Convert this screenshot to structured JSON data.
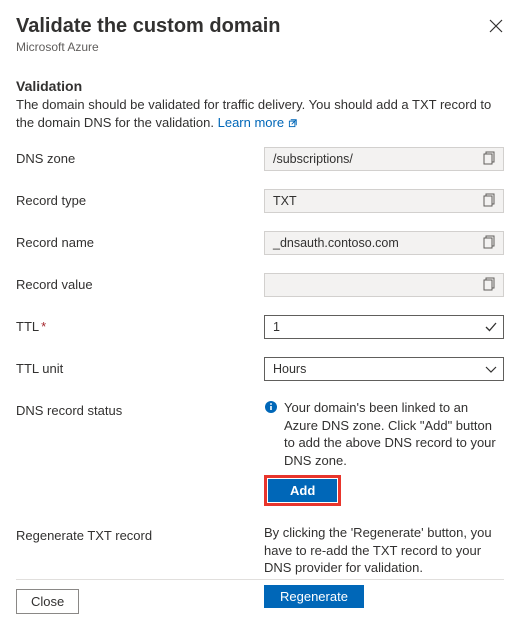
{
  "header": {
    "title": "Validate the custom domain",
    "subtitle": "Microsoft Azure"
  },
  "validation": {
    "heading": "Validation",
    "desc_a": "The domain should be validated for traffic delivery. You should add a TXT record to the domain DNS for the validation. ",
    "learn_more": "Learn more"
  },
  "labels": {
    "dns_zone": "DNS zone",
    "record_type": "Record type",
    "record_name": "Record name",
    "record_value": "Record value",
    "ttl": "TTL",
    "ttl_unit": "TTL unit",
    "dns_status": "DNS record status",
    "regen": "Regenerate TXT record"
  },
  "values": {
    "dns_zone": "/subscriptions/",
    "record_type": "TXT",
    "record_name": "_dnsauth.contoso.com",
    "record_value": "",
    "ttl": "1",
    "ttl_unit": "Hours"
  },
  "status_text": "Your domain's been linked to an Azure DNS zone. Click \"Add\" button to add the above DNS record to your DNS zone.",
  "add_label": "Add",
  "regen_desc": "By clicking the 'Regenerate' button, you have to re-add the TXT record to your DNS provider for validation.",
  "regen_label": "Regenerate",
  "close_label": "Close",
  "colors": {
    "accent": "#0067b8",
    "highlight": "#e8352c"
  }
}
